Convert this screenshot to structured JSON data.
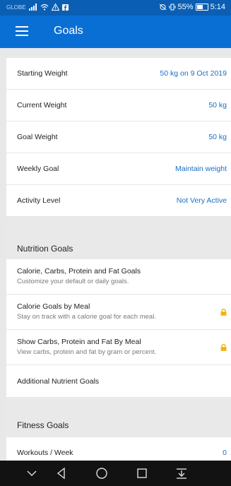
{
  "status_bar": {
    "carrier": "GLOBE",
    "signal_icons": "signal-wifi-alert-facebook-icons",
    "battery_percent": "55%",
    "time": "5:14"
  },
  "header": {
    "title": "Goals",
    "menu_icon": "hamburger-menu-icon"
  },
  "weight": [
    {
      "label": "Starting Weight",
      "value": "50 kg on 9 Oct 2019"
    },
    {
      "label": "Current Weight",
      "value": "50 kg"
    },
    {
      "label": "Goal Weight",
      "value": "50 kg"
    },
    {
      "label": "Weekly Goal",
      "value": "Maintain weight"
    },
    {
      "label": "Activity Level",
      "value": "Not Very Active"
    }
  ],
  "nutrition": {
    "header": "Nutrition Goals",
    "items": [
      {
        "title": "Calorie, Carbs, Protein and Fat Goals",
        "subtitle": "Customize your default or daily goals.",
        "locked": false
      },
      {
        "title": "Calorie Goals by Meal",
        "subtitle": "Stay on track with a calorie goal for each meal.",
        "locked": true
      },
      {
        "title": "Show Carbs, Protein and Fat By Meal",
        "subtitle": "View carbs, protein and fat by gram or percent.",
        "locked": true
      }
    ],
    "additional": "Additional Nutrient Goals"
  },
  "fitness": {
    "header": "Fitness Goals",
    "items": [
      {
        "label": "Workouts / Week",
        "value": "0"
      }
    ]
  },
  "colors": {
    "status_bar": "#0a5fb4",
    "app_bar": "#0a6fd4",
    "value_text": "#1a6fc4",
    "lock": "#f2b400",
    "nav_bar": "#121212"
  }
}
